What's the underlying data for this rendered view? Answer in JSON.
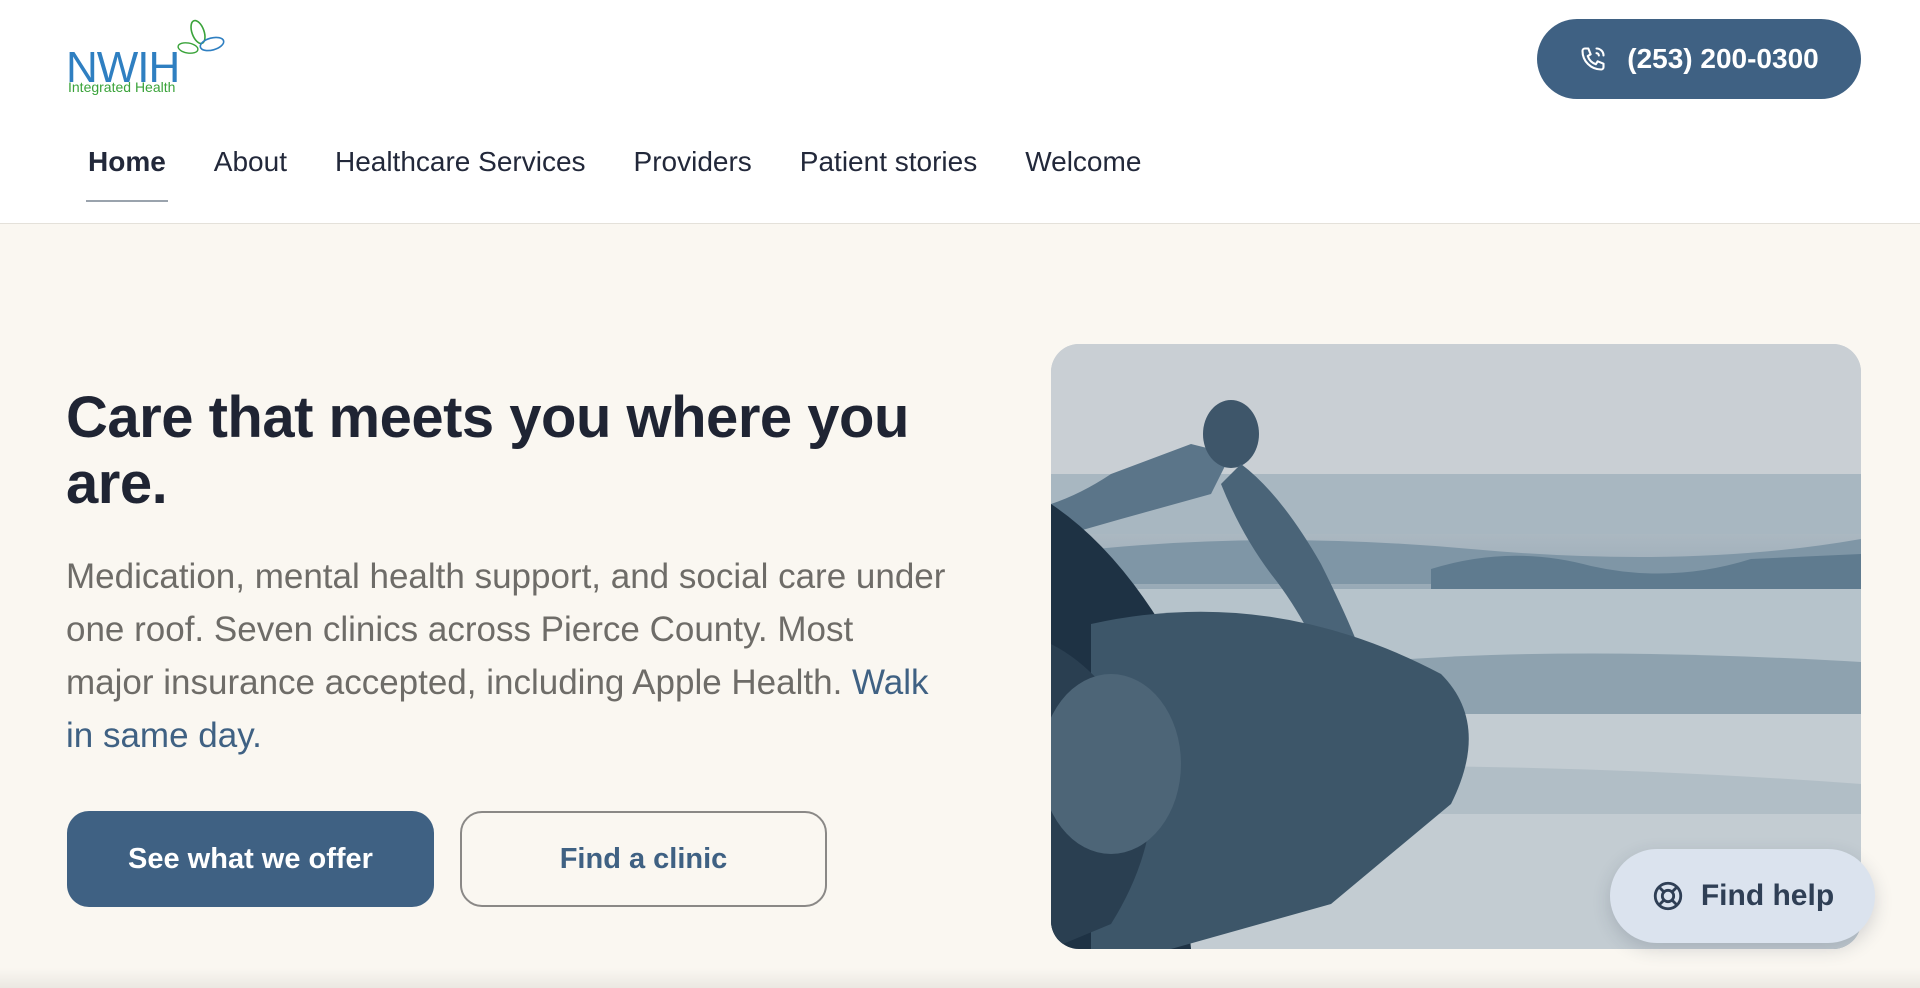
{
  "brand": {
    "logo_text": "NWIH",
    "logo_subtitle": "Integrated Health"
  },
  "header": {
    "phone_label": "(253) 200-0300"
  },
  "nav": {
    "items": [
      {
        "label": "Home",
        "active": true
      },
      {
        "label": "About"
      },
      {
        "label": "Healthcare Services"
      },
      {
        "label": "Providers"
      },
      {
        "label": "Patient stories"
      },
      {
        "label": "Welcome"
      }
    ]
  },
  "hero": {
    "title": "Care that meets you where you are.",
    "description": "Medication, mental health support, and social care under one roof. Seven clinics across Pierce County. Most major insurance accepted, including Apple Health.",
    "description_accent": "Walk in same day.",
    "primary_button": "See what we offer",
    "secondary_button": "Find a clinic"
  },
  "help": {
    "label": "Find help"
  },
  "colors": {
    "primary": "#3f6183",
    "background": "#faf7f1",
    "help_bg": "#dbe3ee"
  },
  "icons": {
    "phone": "phone-icon",
    "help": "lifebuoy-icon"
  }
}
